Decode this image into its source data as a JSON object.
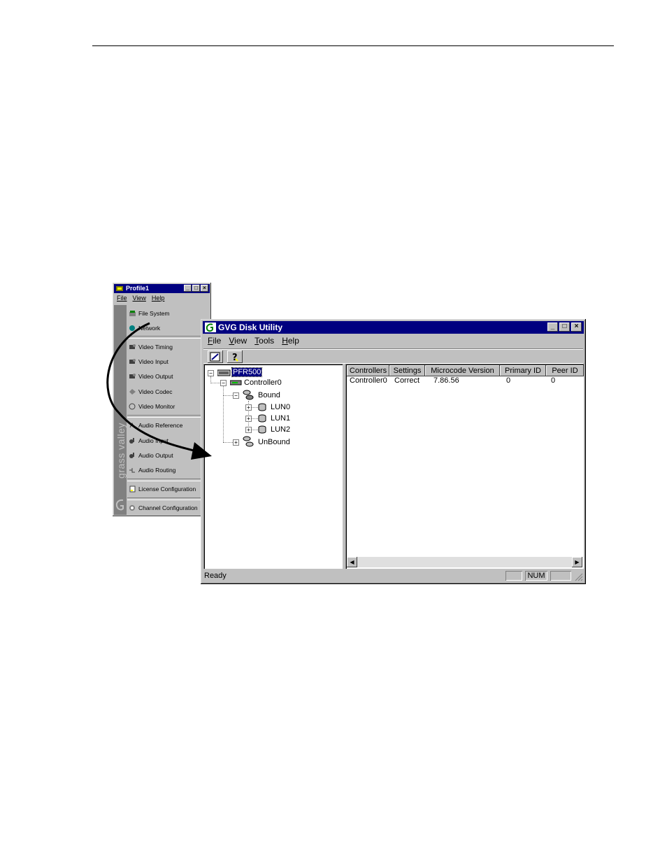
{
  "profile_window": {
    "title": "Profile1",
    "menu": [
      "File",
      "View",
      "Help"
    ],
    "brand_text": "grass valley",
    "items": [
      {
        "label": "File System",
        "icon": "file-system-icon"
      },
      {
        "label": "Network",
        "icon": "network-icon"
      },
      {
        "label": "Video Timing",
        "icon": "video-timing-icon"
      },
      {
        "label": "Video Input",
        "icon": "video-input-icon"
      },
      {
        "label": "Video Output",
        "icon": "video-output-icon"
      },
      {
        "label": "Video Codec",
        "icon": "video-codec-icon"
      },
      {
        "label": "Video Monitor",
        "icon": "video-monitor-icon"
      },
      {
        "label": "Audio Reference",
        "icon": "audio-reference-icon"
      },
      {
        "label": "Audio Input",
        "icon": "audio-input-icon"
      },
      {
        "label": "Audio Output",
        "icon": "audio-output-icon"
      },
      {
        "label": "Audio Routing",
        "icon": "audio-routing-icon"
      },
      {
        "label": "License Configuration",
        "icon": "license-icon"
      },
      {
        "label": "Channel Configuration",
        "icon": "channel-icon"
      }
    ]
  },
  "gvg_window": {
    "title": "GVG Disk Utility",
    "menu": [
      "File",
      "View",
      "Tools",
      "Help"
    ],
    "toolbar": {
      "edit_icon": "edit-icon",
      "help_icon": "help-icon"
    },
    "tree": {
      "root": "PFR500",
      "controller": "Controller0",
      "bound": "Bound",
      "luns": [
        "LUN0",
        "LUN1",
        "LUN2"
      ],
      "unbound": "UnBound"
    },
    "table": {
      "columns": [
        "Controllers",
        "Settings",
        "Microcode Version",
        "Primary ID",
        "Peer ID"
      ],
      "rows": [
        [
          "Controller0",
          "Correct",
          "7.86.56",
          "0",
          "0"
        ]
      ]
    },
    "status": {
      "text": "Ready",
      "num": "NUM"
    }
  }
}
